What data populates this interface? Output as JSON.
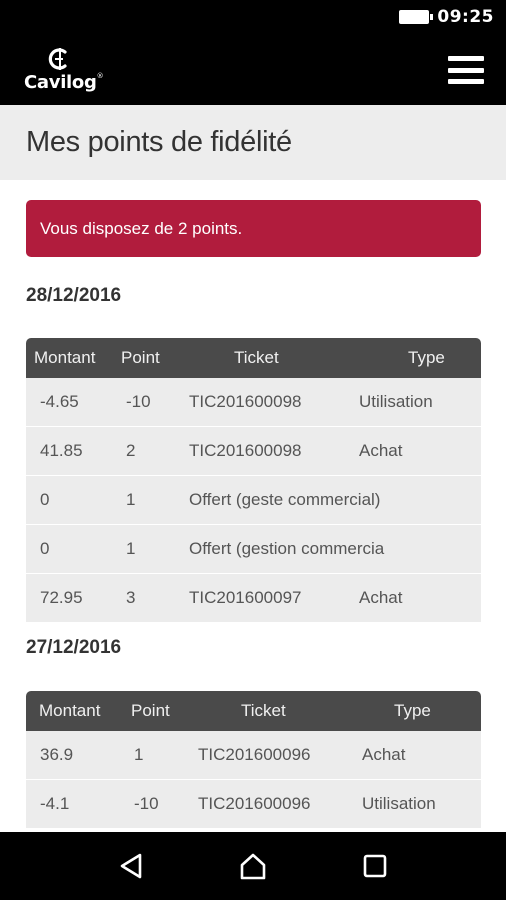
{
  "status_bar": {
    "time": "09:25"
  },
  "app_bar": {
    "logo_text": "Cavilog",
    "logo_reg": "®"
  },
  "page": {
    "title": "Mes points de fidélité"
  },
  "alert": {
    "text": "Vous disposez de 2 points."
  },
  "groups": [
    {
      "date": "28/12/2016",
      "headers": {
        "montant": "Montant",
        "point": "Point",
        "ticket": "Ticket",
        "type": "Type"
      },
      "rows": [
        {
          "montant": "-4.65",
          "point": "-10",
          "ticket": "TIC201600098",
          "type": "Utilisation"
        },
        {
          "montant": "41.85",
          "point": "2",
          "ticket": "TIC201600098",
          "type": "Achat"
        },
        {
          "montant": "0",
          "point": "1",
          "ticket": "Offert (geste commercial)",
          "type": ""
        },
        {
          "montant": "0",
          "point": "1",
          "ticket": "Offert (gestion commercia",
          "type": ""
        },
        {
          "montant": "72.95",
          "point": "3",
          "ticket": "TIC201600097",
          "type": "Achat"
        }
      ]
    },
    {
      "date": "27/12/2016",
      "headers": {
        "montant": "Montant",
        "point": "Point",
        "ticket": "Ticket",
        "type": "Type"
      },
      "rows": [
        {
          "montant": "36.9",
          "point": "1",
          "ticket": "TIC201600096",
          "type": "Achat"
        },
        {
          "montant": "-4.1",
          "point": "-10",
          "ticket": "TIC201600096",
          "type": "Utilisation"
        }
      ]
    }
  ],
  "icons": {
    "menu": "hamburger-menu-icon",
    "back": "back-triangle-icon",
    "home": "home-icon",
    "recents": "recents-square-icon",
    "battery": "battery-icon"
  },
  "colors": {
    "accent": "#b11c3d",
    "table_header": "#4a4a4a",
    "row_bg": "#ececec"
  }
}
